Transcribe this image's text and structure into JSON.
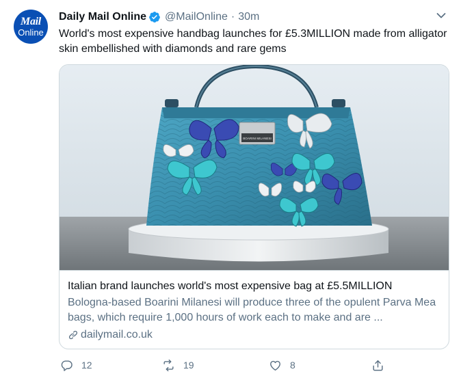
{
  "tweet": {
    "avatar": {
      "line1": "Mail",
      "line2": "Online"
    },
    "author_name": "Daily Mail Online",
    "handle": "@MailOnline",
    "separator": "·",
    "time": "30m",
    "text": "World's most expensive handbag launches for £5.3MILLION made from alligator skin embellished with diamonds and rare gems"
  },
  "card": {
    "title": "Italian brand launches world's most expensive bag at £5.5MILLION",
    "description": "Bologna-based Boarini Milanesi will produce three of the opulent Parva Mea bags, which require 1,000 hours of work each to make and are ...",
    "domain": "dailymail.co.uk",
    "image_plaque_text": "BOARINI MILANESI"
  },
  "actions": {
    "reply_count": "12",
    "retweet_count": "19",
    "like_count": "8"
  },
  "colors": {
    "accent": "#1d9bf0",
    "text_primary": "#0f1419",
    "text_secondary": "#5b7083",
    "border": "#cfd9de",
    "avatar_bg": "#0a4fb4",
    "bag_teal": "#3a8fae"
  },
  "icons": [
    "verified-badge-icon",
    "chevron-down-icon",
    "link-icon",
    "reply-icon",
    "retweet-icon",
    "like-icon",
    "share-icon"
  ]
}
